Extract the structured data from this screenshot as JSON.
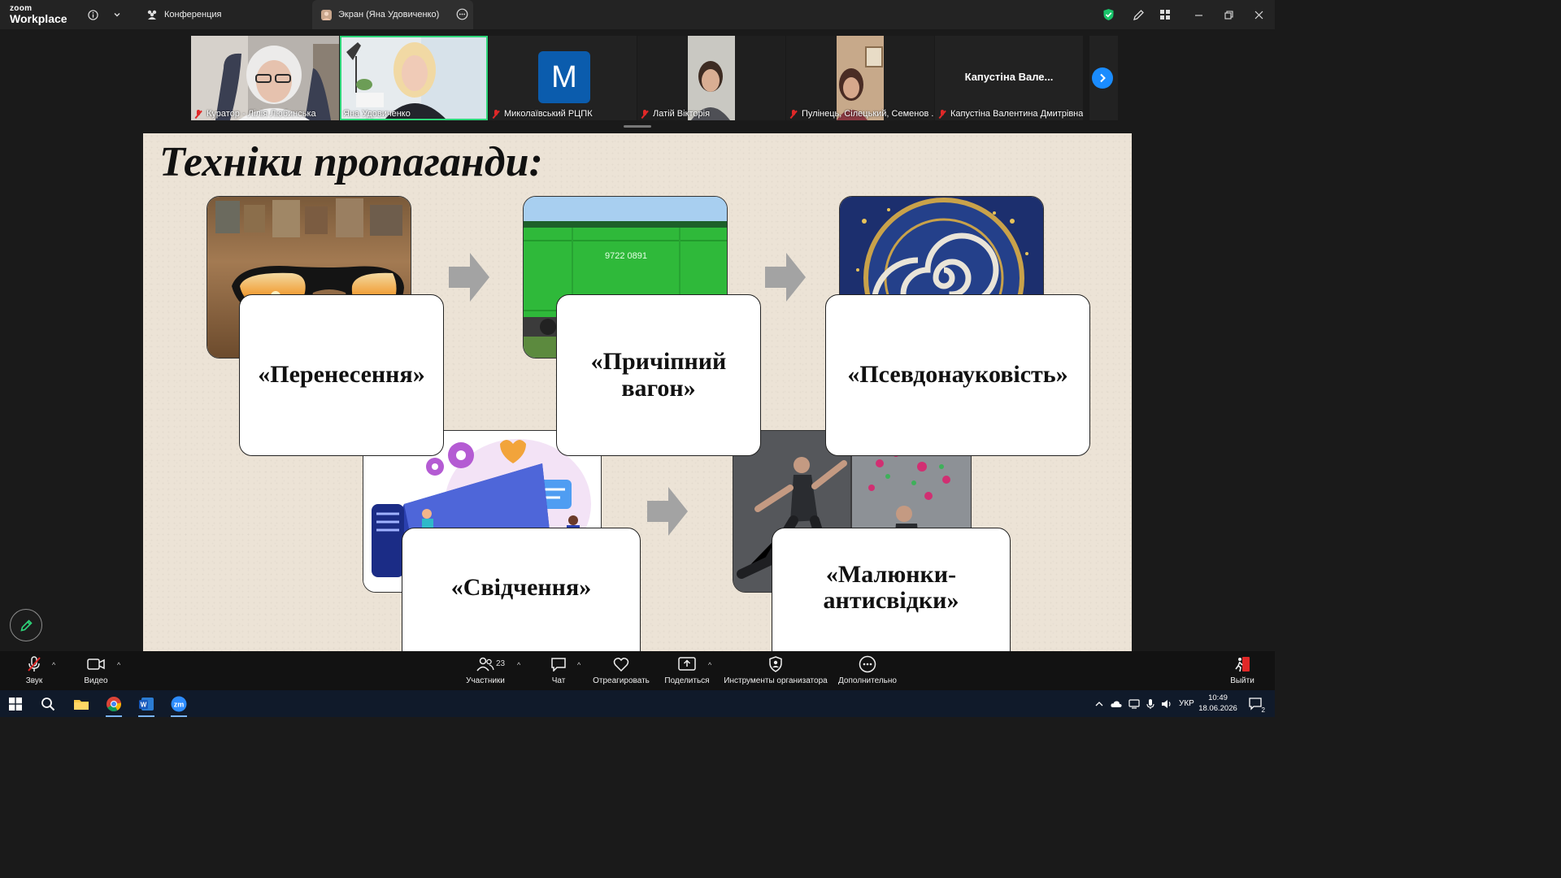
{
  "app": {
    "logo_top": "zoom",
    "logo_bottom": "Workplace"
  },
  "tabs": [
    {
      "label": "Конференция",
      "icon": "people-icon"
    },
    {
      "label": "Экран (Яна Удовиченко)",
      "icon": "user-thumb-icon"
    }
  ],
  "participants": [
    {
      "name": "Куратор - Лілія Любинська",
      "muted": true
    },
    {
      "name": "Яна Удовиченко",
      "muted": false,
      "speaking": true
    },
    {
      "name": "Миколаївський РЦПК",
      "muted": true,
      "avatar_letter": "M"
    },
    {
      "name": "Латій Вікторія",
      "muted": true
    },
    {
      "name": "Пулінець, Сілецький, Семенов ...",
      "muted": true
    },
    {
      "name": "Капустіна Валентина Дмитрівна",
      "muted": true,
      "display_label": "Капустіна Вале..."
    }
  ],
  "slide": {
    "title": "Техніки пропаганди:",
    "cards": [
      {
        "text": "«Перенесення»"
      },
      {
        "text": "«Причіпний вагон»"
      },
      {
        "text": "«Псевдонауковість»"
      },
      {
        "text": "«Свідчення»"
      },
      {
        "text": "«Малюнки-антисвідки»"
      }
    ],
    "wagon_text": "9722 0891"
  },
  "toolbar": {
    "audio": "Звук",
    "video": "Видео",
    "participants": "Участники",
    "participants_count": "23",
    "chat": "Чат",
    "react": "Отреагировать",
    "share": "Поделиться",
    "host_tools": "Инструменты организатора",
    "more": "Дополнительно",
    "leave": "Выйти"
  },
  "taskbar": {
    "language": "УКР",
    "time": "10:49",
    "date": "18.06.2026",
    "notifications": "2"
  },
  "colors": {
    "accent": "#1a8cff",
    "speaking": "#2ed67a",
    "muted": "#e02828",
    "shield": "#19c46a"
  }
}
